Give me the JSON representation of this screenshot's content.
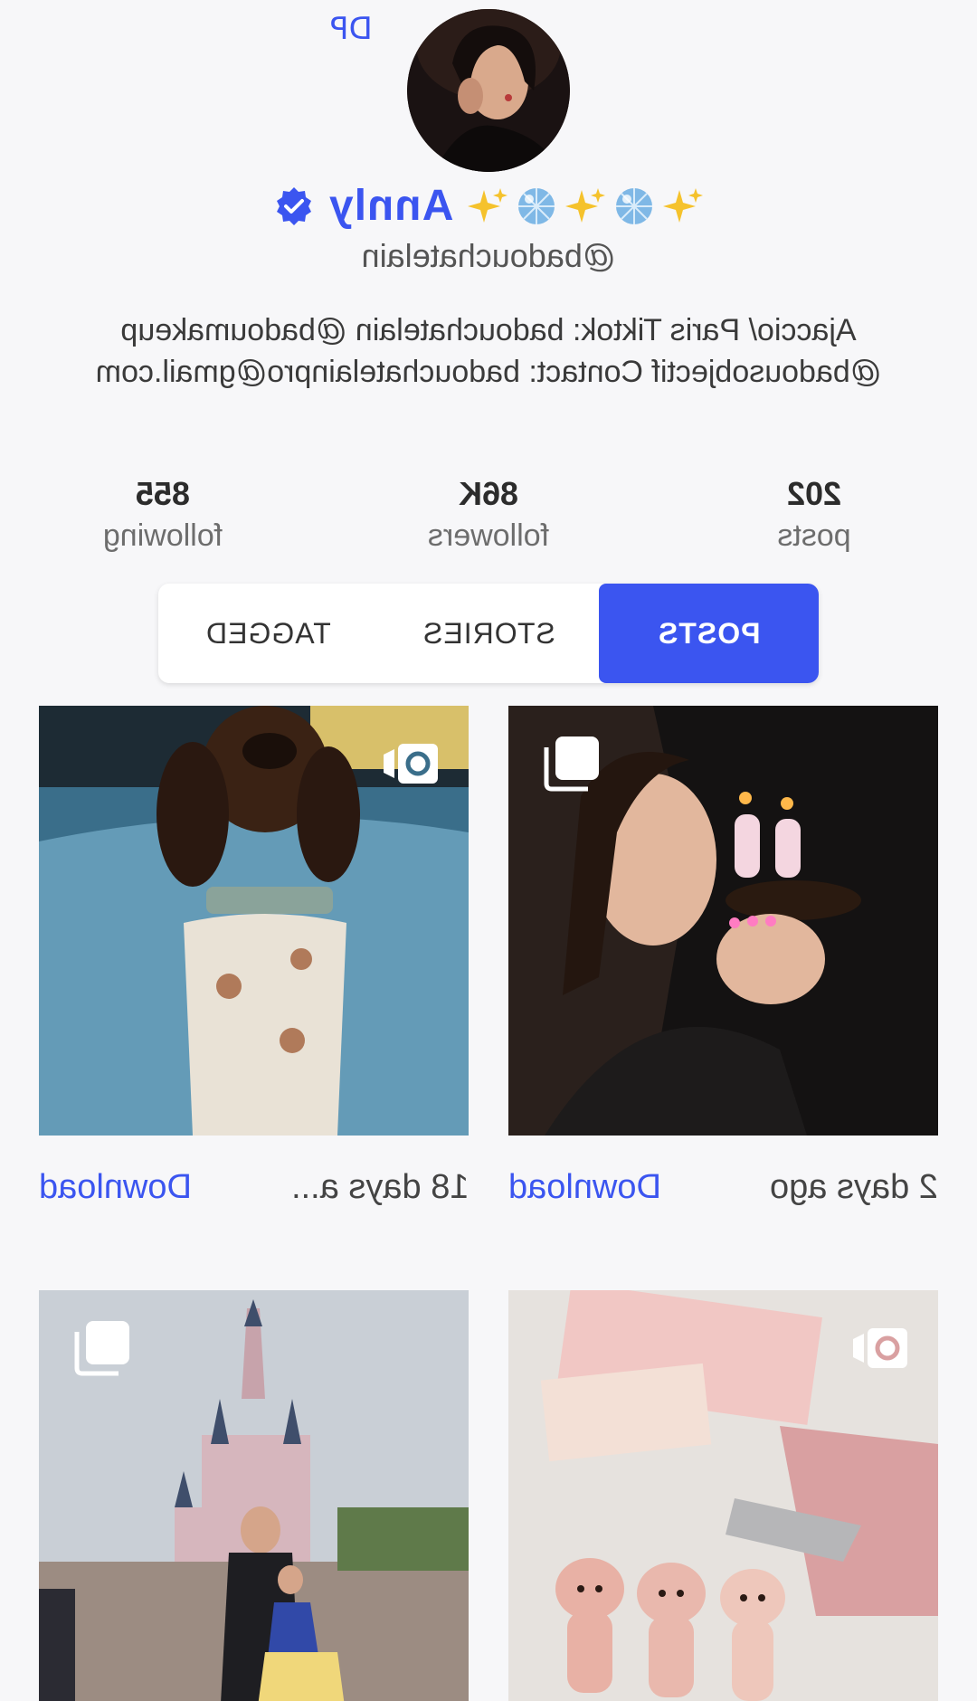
{
  "profile": {
    "dp_label": "DP",
    "name": "Annly",
    "handle": "@badouchatelain",
    "bio": "Ajaccio/ Paris Tiktok: badouchatelain @badoumakeup @badousobjectif Contact: badouchatelainpro@gmail.com",
    "verified": true
  },
  "stats": [
    {
      "value": "202",
      "label": "posts"
    },
    {
      "value": "86K",
      "label": "followers"
    },
    {
      "value": "855",
      "label": "following"
    }
  ],
  "tabs": [
    {
      "label": "POSTS",
      "active": true
    },
    {
      "label": "STORIES",
      "active": false
    },
    {
      "label": "TAGGED",
      "active": false
    }
  ],
  "posts": [
    {
      "date": "2 days ago",
      "download_label": "Download",
      "icon": "multiple-photos-icon"
    },
    {
      "date": "18 days a...",
      "download_label": "Download",
      "icon": "camera-icon"
    },
    {
      "date": "",
      "download_label": "",
      "icon": "camera-icon"
    },
    {
      "date": "",
      "download_label": "",
      "icon": "multiple-photos-icon"
    }
  ],
  "colors": {
    "accent": "#3b55f0",
    "background": "#f7f7f9"
  }
}
